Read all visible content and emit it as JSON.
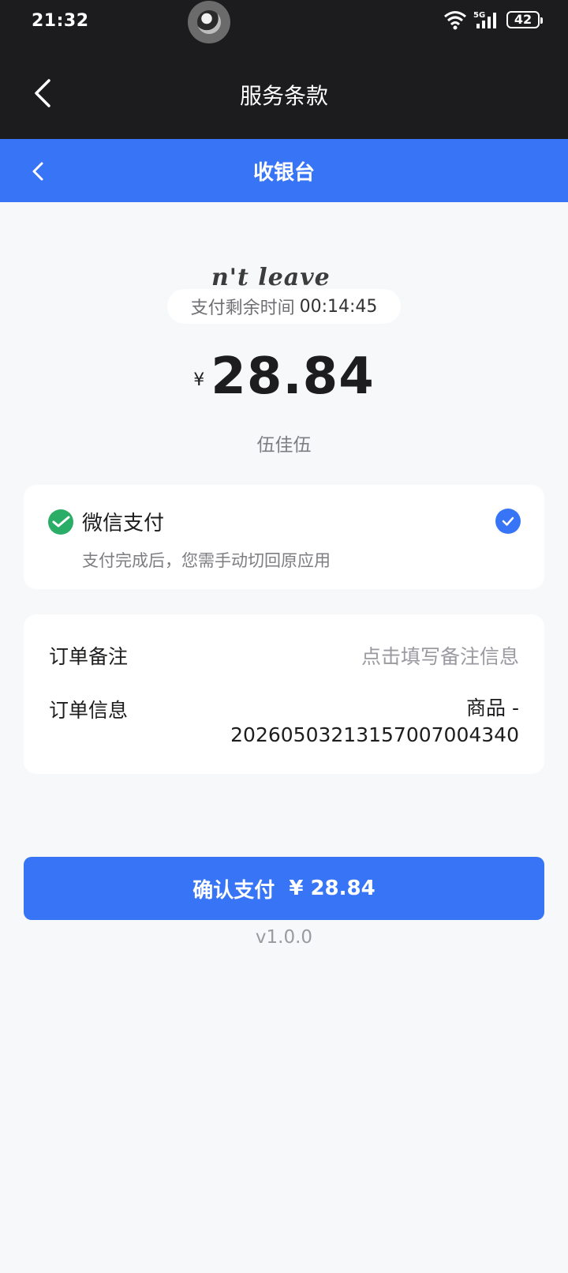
{
  "status_bar": {
    "time": "21:32",
    "network": "5G",
    "battery": "42"
  },
  "outer_header": {
    "title": "服务条款"
  },
  "checkout_header": {
    "title": "收银台"
  },
  "overlay_text": "n't leave",
  "timer": {
    "label": "支付剩余时间",
    "value": "00:14:45"
  },
  "amount": {
    "currency": "¥",
    "value": "28.84"
  },
  "merchant": "伍佳伍",
  "payment_method": {
    "name": "微信支付",
    "hint": "支付完成后，您需手动切回原应用",
    "selected": true,
    "accent": "#3875f6",
    "icon_color": "#2aae67"
  },
  "order": {
    "remark_label": "订单备注",
    "remark_placeholder": "点击填写备注信息",
    "info_label": "订单信息",
    "info_value_line1": "商品 -",
    "info_value_line2": "20260503213157007004340"
  },
  "confirm_button": {
    "label": "确认支付",
    "amount": "¥ 28.84"
  },
  "version": "v1.0.0"
}
